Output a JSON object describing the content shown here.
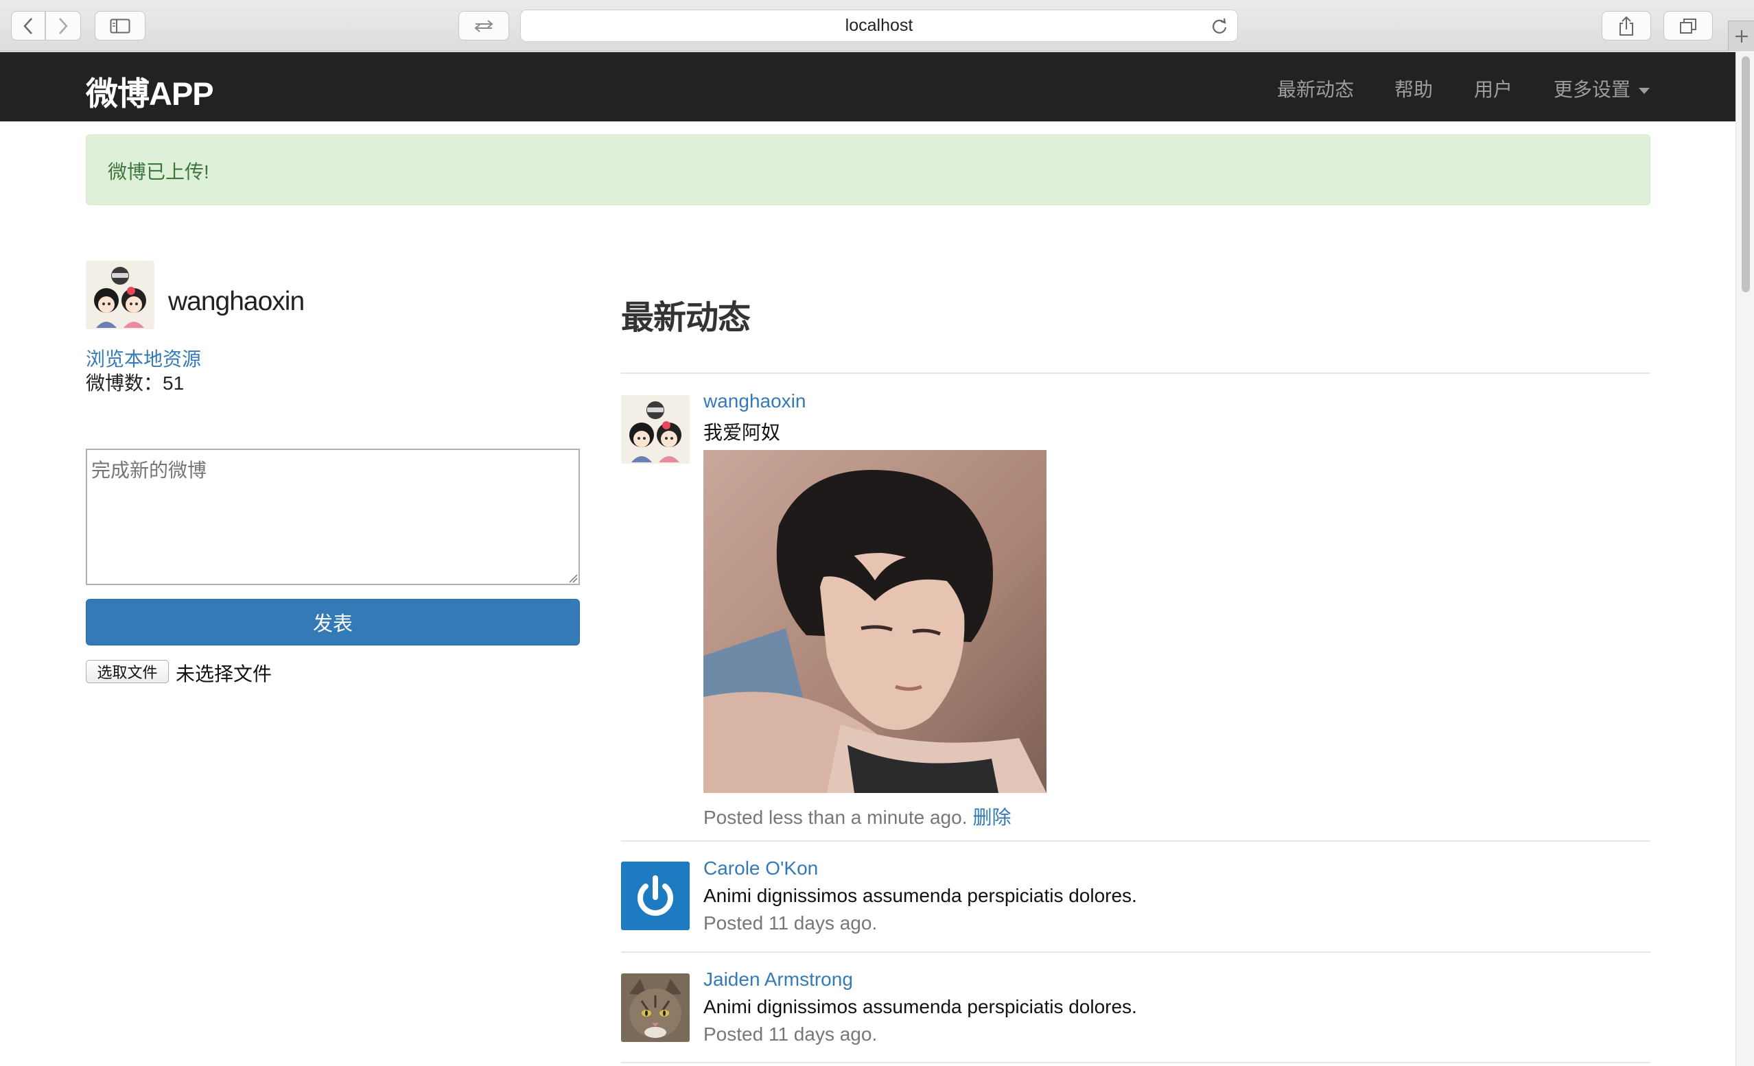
{
  "browser": {
    "url": "localhost"
  },
  "navbar": {
    "brand": "微博APP",
    "links": [
      "最新动态",
      "帮助",
      "用户"
    ],
    "more_settings": "更多设置"
  },
  "alert": {
    "message": "微博已上传!"
  },
  "sidebar": {
    "username": "wanghaoxin",
    "browse_link": "浏览本地资源",
    "count_label": "微博数：51",
    "compose_placeholder": "完成新的微博",
    "submit_label": "发表",
    "file_button": "选取文件",
    "file_status": "未选择文件"
  },
  "feed": {
    "title": "最新动态",
    "posts": [
      {
        "user": "wanghaoxin",
        "text": "我爱阿奴",
        "meta": "Posted less than a minute ago.",
        "delete_label": "删除",
        "avatar": "cartoon-couple-avatar",
        "has_image": true
      },
      {
        "user": "Carole O'Kon",
        "text": "Animi dignissimos assumenda perspiciatis dolores.",
        "meta": "Posted 11 days ago.",
        "avatar": "power-symbol-avatar"
      },
      {
        "user": "Jaiden Armstrong",
        "text": "Animi dignissimos assumenda perspiciatis dolores.",
        "meta": "Posted 11 days ago.",
        "avatar": "cat-avatar"
      }
    ]
  },
  "colors": {
    "navbar_bg": "#222222",
    "link": "#337ab7",
    "alert_bg": "#dff0d8",
    "alert_text": "#3c763d",
    "button_primary": "#337ab7"
  }
}
